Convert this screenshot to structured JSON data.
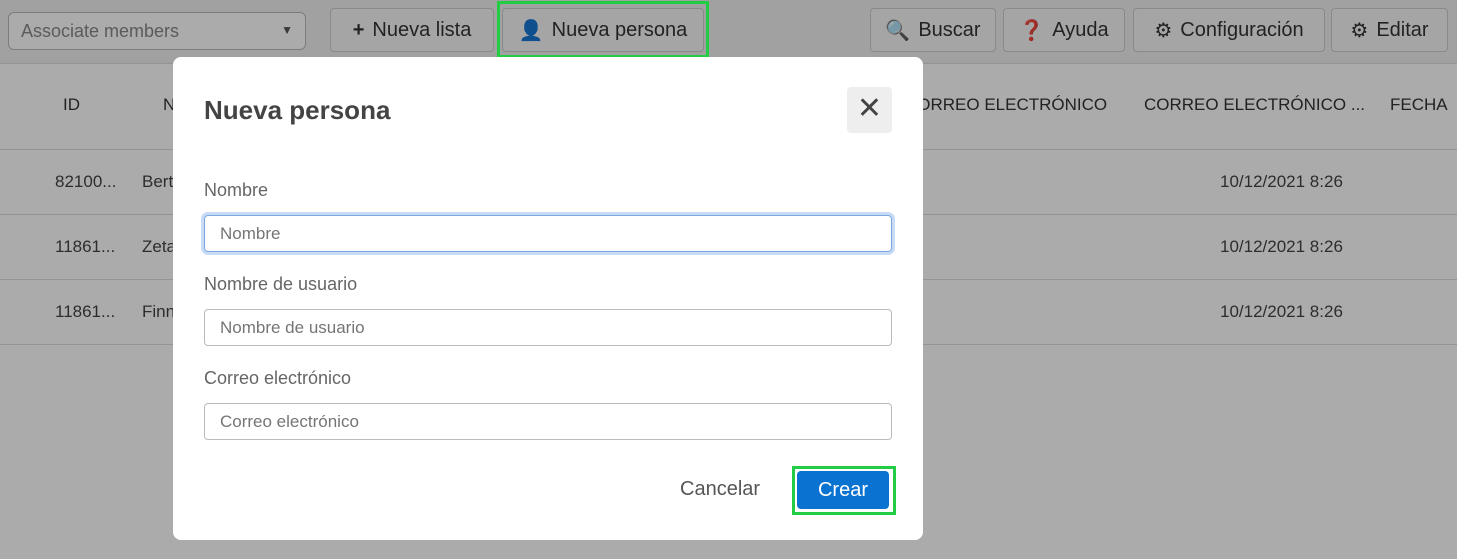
{
  "toolbar": {
    "list_select": "Associate members",
    "new_list": "Nueva lista",
    "new_person": "Nueva persona",
    "search": "Buscar",
    "help": "Ayuda",
    "settings": "Configuración",
    "edit": "Editar"
  },
  "table": {
    "headers": [
      "ID",
      "N",
      "CORREO ELECTRÓNICO",
      "CORREO ELECTRÓNICO ...",
      "FECHA"
    ],
    "rows": [
      {
        "id": "82100...",
        "name": "Bert",
        "date": "10/12/2021 8:26"
      },
      {
        "id": "11861...",
        "name": "Zeta",
        "date": "10/12/2021 8:26"
      },
      {
        "id": "11861...",
        "name": "Finn",
        "date": "10/12/2021 8:26"
      }
    ]
  },
  "modal": {
    "title": "Nueva persona",
    "name_label": "Nombre",
    "name_placeholder": "Nombre",
    "username_label": "Nombre de usuario",
    "username_placeholder": "Nombre de usuario",
    "email_label": "Correo electrónico",
    "email_placeholder": "Correo electrónico",
    "cancel": "Cancelar",
    "create": "Crear"
  },
  "colors": {
    "primary": "#0a72d1",
    "highlight": "#22cc44"
  }
}
